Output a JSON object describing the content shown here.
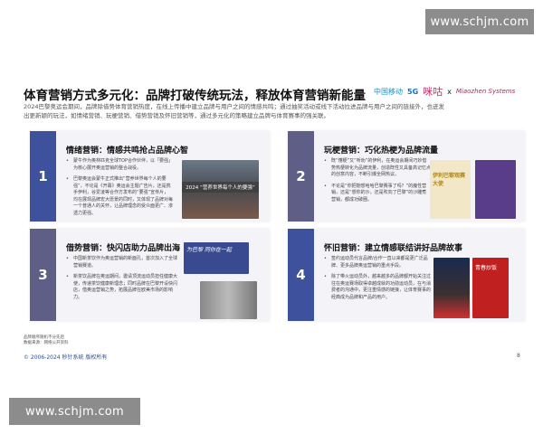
{
  "watermark": "www.schjm.com",
  "title": "体育营销方式多元化：品牌打破传统玩法，释放体育营销新能量",
  "logos": {
    "china_mobile": "中国移动",
    "fiveg": "5G",
    "migu": "咪咕",
    "x": "x",
    "miaozhen": "Miaozhen Systems"
  },
  "intro": "2024巴黎奥运会期间，品牌除借势体育营销热度，在线上传播中建立品牌与用户之间的情感共鸣；通过抽奖活动或线下活动拉进品牌与用户之间的链接外，也迸发出更新颖的玩法，如情绪营销、玩梗营销、借势营销及怀旧营销等，通过多元化的策略建立品牌与体育赛事的强关联。",
  "cards": [
    {
      "num": "1",
      "title": "情绪营销：情感共鸣抢占品牌心智",
      "bullets": [
        "蒙牛作为奥林匹克全球TOP合作伙伴，以「要强」为核心展开奥运营销的整合战役。",
        "巴黎奥运会蒙牛正式推出“营养世界每个人的要强”，不论是《开幕》奥运会主题广告片，还是携手伊利，谷爱凌等合作方发布的“要强”宣传片，均在展现品牌宏大愿景的同时，又体现了品牌对每一个普通人的关怀，让品牌理念的受众面更广、渗透力更强。"
      ],
      "image_caption": "2024 “营养世界每个人的要强”"
    },
    {
      "num": "2",
      "title": "玩梗营销：巧化热梗为品牌流量",
      "bullets": [
        "既“懂梗”又“听劝”的伊利，在奥运会期间巧妙借势热梗转化为品牌流量，创造既性又具备高记忆点的创意内容，不断引爆全网热议。",
        "不论是“你把匏想哈哈巴黎赛事了吗？”的魔性营销，还是“想你的沙，还是吹向了巴黎”的沙雕煮营销，都成功破圈。"
      ],
      "image_caption": "伊利巴黎观赛大使"
    },
    {
      "num": "3",
      "title": "借势营销：快闪店助力品牌出海",
      "bullets": [
        "中国新茶饮作为奥运营销的新面孔，首次加入了全球营销赛道。",
        "新茶饮品牌在奥运期间，邀请顶流运动员担任健康大使，传递茶饮健康新理念；同时品牌在巴黎开设快闪店，借奥运营销之势，拓展品牌在欧美市场的影响力。"
      ],
      "image_caption": "为巴黎 同你在一起"
    },
    {
      "num": "4",
      "title": "怀旧营销：建立情感联结讲好品牌故事",
      "bullets": [
        "签约运动员代言品牌/合作一直以来都是更广泛品牌、更多品牌奥运营销的重点手段。",
        "除了带火运动员外，越来越多的品牌都开始关注过往在奥运赛场取得卓越成就的功勋运动员，在与消费者的沟通中，更注重情感的链接，让体育赛事的经典成为品牌和产品的用户。"
      ],
      "image_caption": "青春炒饭"
    }
  ],
  "footnote": [
    "品牌顺序随机不分先后",
    "数据来源：网络公开资料"
  ],
  "copyright": "© 2006-2024 秒针系统 版权所有",
  "page": "8",
  "colors": {
    "blue": "#3d519c",
    "purple": "#5e5e86"
  }
}
